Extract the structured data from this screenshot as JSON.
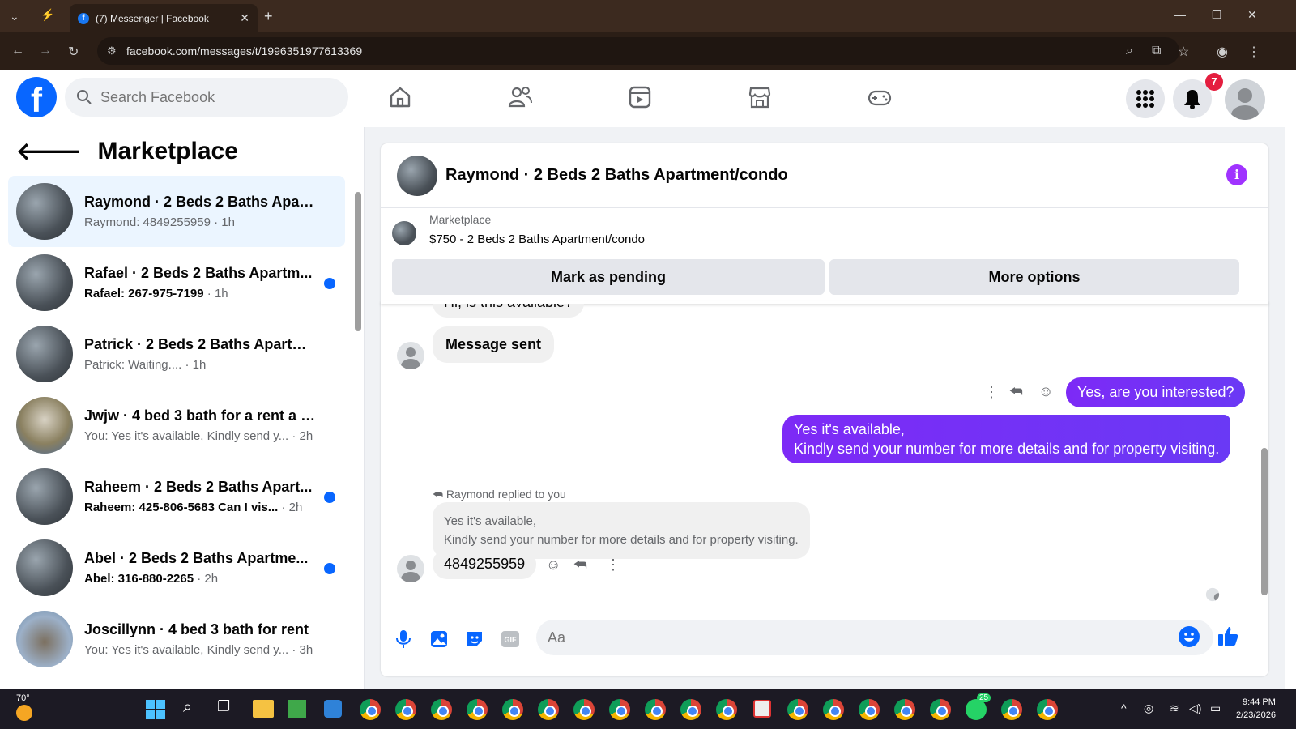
{
  "browser": {
    "tab_title": "(7) Messenger | Facebook",
    "url": "facebook.com/messages/t/1996351977613369"
  },
  "fb": {
    "search_placeholder": "Search Facebook",
    "notification_count": "7"
  },
  "sidebar": {
    "title": "Marketplace",
    "conversations": [
      {
        "name": "Raymond · 2 Beds 2 Baths Apart...",
        "preview": "Raymond: 4849255959",
        "time": " · 1h",
        "unread": false,
        "active": true
      },
      {
        "name": "Rafael · 2 Beds 2 Baths Apartm...",
        "preview": "Rafael: 267-975-7199",
        "time": " · 1h",
        "unread": true,
        "active": false
      },
      {
        "name": "Patrick · 2 Beds 2 Baths Apartme...",
        "preview": "Patrick: Waiting....",
        "time": " · 1h",
        "unread": false,
        "active": false
      },
      {
        "name": "Jwjw · 4 bed 3 bath for a rent a h...",
        "preview": "You: Yes it's available, Kindly send y...",
        "time": " · 2h",
        "unread": false,
        "active": false
      },
      {
        "name": "Raheem · 2 Beds 2 Baths Apart...",
        "preview": "Raheem: 425-806-5683 Can I vis...",
        "time": " · 2h",
        "unread": true,
        "active": false
      },
      {
        "name": "Abel · 2 Beds 2 Baths Apartme...",
        "preview": "Abel: 316-880-2265",
        "time": " · 2h",
        "unread": true,
        "active": false
      },
      {
        "name": "Joscillynn · 4 bed 3 bath for rent",
        "preview": "You: Yes it's available, Kindly send y...",
        "time": " · 3h",
        "unread": false,
        "active": false
      }
    ]
  },
  "chat": {
    "title": "Raymond · 2 Beds 2 Baths Apartment/condo",
    "marketplace_label": "Marketplace",
    "listing": "$750 - 2 Beds 2 Baths Apartment/condo",
    "mark_pending": "Mark as pending",
    "more_options": "More options",
    "messages": {
      "m1": "Hi, is this available?",
      "m2": "Message sent",
      "m3": "Yes, are you interested?",
      "m4_line1": "Yes it's available,",
      "m4_line2": "Kindly send your number for more details and for property visiting.",
      "replied_label": "Raymond replied to you",
      "quote_line1": "Yes it's available,",
      "quote_line2": "Kindly send your number for more details and for property visiting.",
      "m5": "4849255959"
    },
    "composer_placeholder": "Aa"
  },
  "taskbar": {
    "weather": "70°",
    "time": "9:44 PM",
    "date": "2/23/2026",
    "whatsapp_badge": "25"
  },
  "colors": {
    "fb_blue": "#0866ff",
    "outgoing_bubble": "#7b2ff7",
    "info_icon": "#a033ff",
    "unread_dot": "#0866ff"
  }
}
